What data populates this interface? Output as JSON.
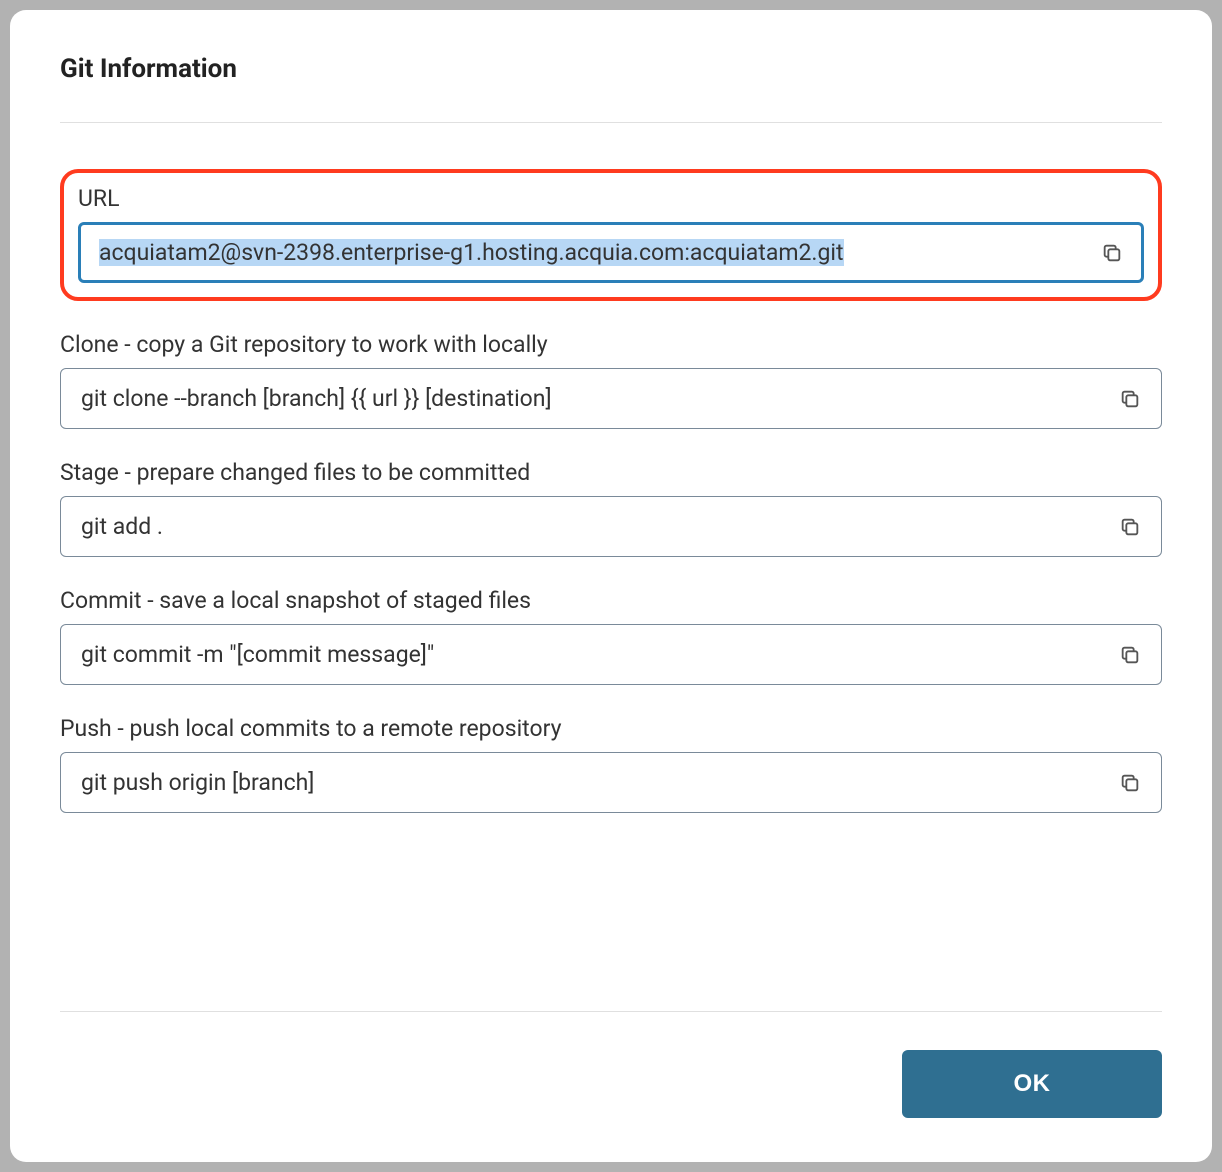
{
  "modal": {
    "title": "Git Information",
    "url_label": "URL",
    "url_value": "acquiatam2@svn-2398.enterprise-g1.hosting.acquia.com:acquiatam2.git",
    "clone_label": "Clone - copy a Git repository to work with locally",
    "clone_value": "git clone --branch [branch] {{ url }} [destination]",
    "stage_label": "Stage - prepare changed files to be committed",
    "stage_value": "git add .",
    "commit_label": "Commit - save a local snapshot of staged files",
    "commit_value": "git commit -m \"[commit message]\"",
    "push_label": "Push - push local commits to a remote repository",
    "push_value": "git push origin [branch]",
    "ok_button": "OK"
  }
}
